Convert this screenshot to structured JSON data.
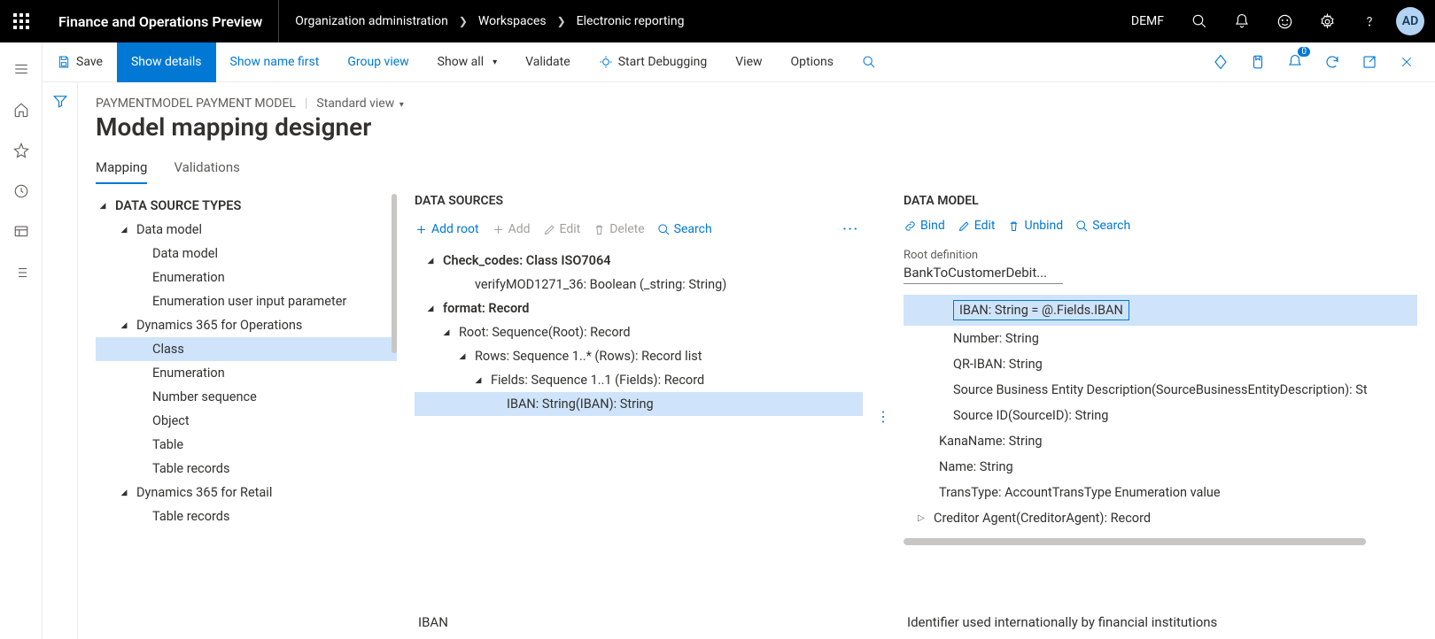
{
  "header": {
    "app_title": "Finance and Operations Preview",
    "breadcrumbs": [
      "Organization administration",
      "Workspaces",
      "Electronic reporting"
    ],
    "env": "DEMF",
    "avatar_initials": "AD"
  },
  "actionbar": {
    "save": "Save",
    "show_details": "Show details",
    "show_name_first": "Show name first",
    "group_view": "Group view",
    "show_all": "Show all",
    "validate": "Validate",
    "start_debugging": "Start Debugging",
    "view": "View",
    "options": "Options",
    "notif_count": "0"
  },
  "crumb": {
    "path1": "PAYMENTMODEL PAYMENT MODEL",
    "view_name": "Standard view"
  },
  "page_title": "Model mapping designer",
  "tabs": {
    "mapping": "Mapping",
    "validations": "Validations"
  },
  "source_types": {
    "heading": "DATA SOURCE TYPES",
    "items": {
      "data_model_root": "Data model",
      "data_model": "Data model",
      "enumeration": "Enumeration",
      "enum_user_input": "Enumeration user input parameter",
      "d365_ops": "Dynamics 365 for Operations",
      "class": "Class",
      "enumeration2": "Enumeration",
      "number_sequence": "Number sequence",
      "object": "Object",
      "table": "Table",
      "table_records": "Table records",
      "d365_retail": "Dynamics 365 for Retail",
      "table_records2": "Table records"
    }
  },
  "data_sources": {
    "heading": "DATA SOURCES",
    "tools": {
      "add_root": "Add root",
      "add": "Add",
      "edit": "Edit",
      "delete": "Delete",
      "search": "Search"
    },
    "tree": {
      "check_codes": "Check_codes: Class ISO7064",
      "verify": "verifyMOD1271_36: Boolean (_string: String)",
      "format": "format: Record",
      "root": "Root: Sequence(Root): Record",
      "rows": "Rows: Sequence 1..* (Rows): Record list",
      "fields": "Fields: Sequence 1..1 (Fields): Record",
      "iban": "IBAN: String(IBAN): String"
    },
    "selected_label": "IBAN"
  },
  "data_model": {
    "heading": "DATA MODEL",
    "tools": {
      "bind": "Bind",
      "edit": "Edit",
      "unbind": "Unbind",
      "search": "Search"
    },
    "root_def_label": "Root definition",
    "root_def_value": "BankToCustomerDebit...",
    "tree": {
      "iban": "IBAN: String = @.Fields.IBAN",
      "number": "Number: String",
      "qr_iban": "QR-IBAN: String",
      "sbed": "Source Business Entity Description(SourceBusinessEntityDescription): St",
      "source_id": "Source ID(SourceID): String",
      "kananame": "KanaName: String",
      "name": "Name: String",
      "transtype": "TransType: AccountTransType Enumeration value",
      "creditor_agent": "Creditor Agent(CreditorAgent): Record"
    },
    "description": "Identifier used internationally by financial institutions"
  }
}
